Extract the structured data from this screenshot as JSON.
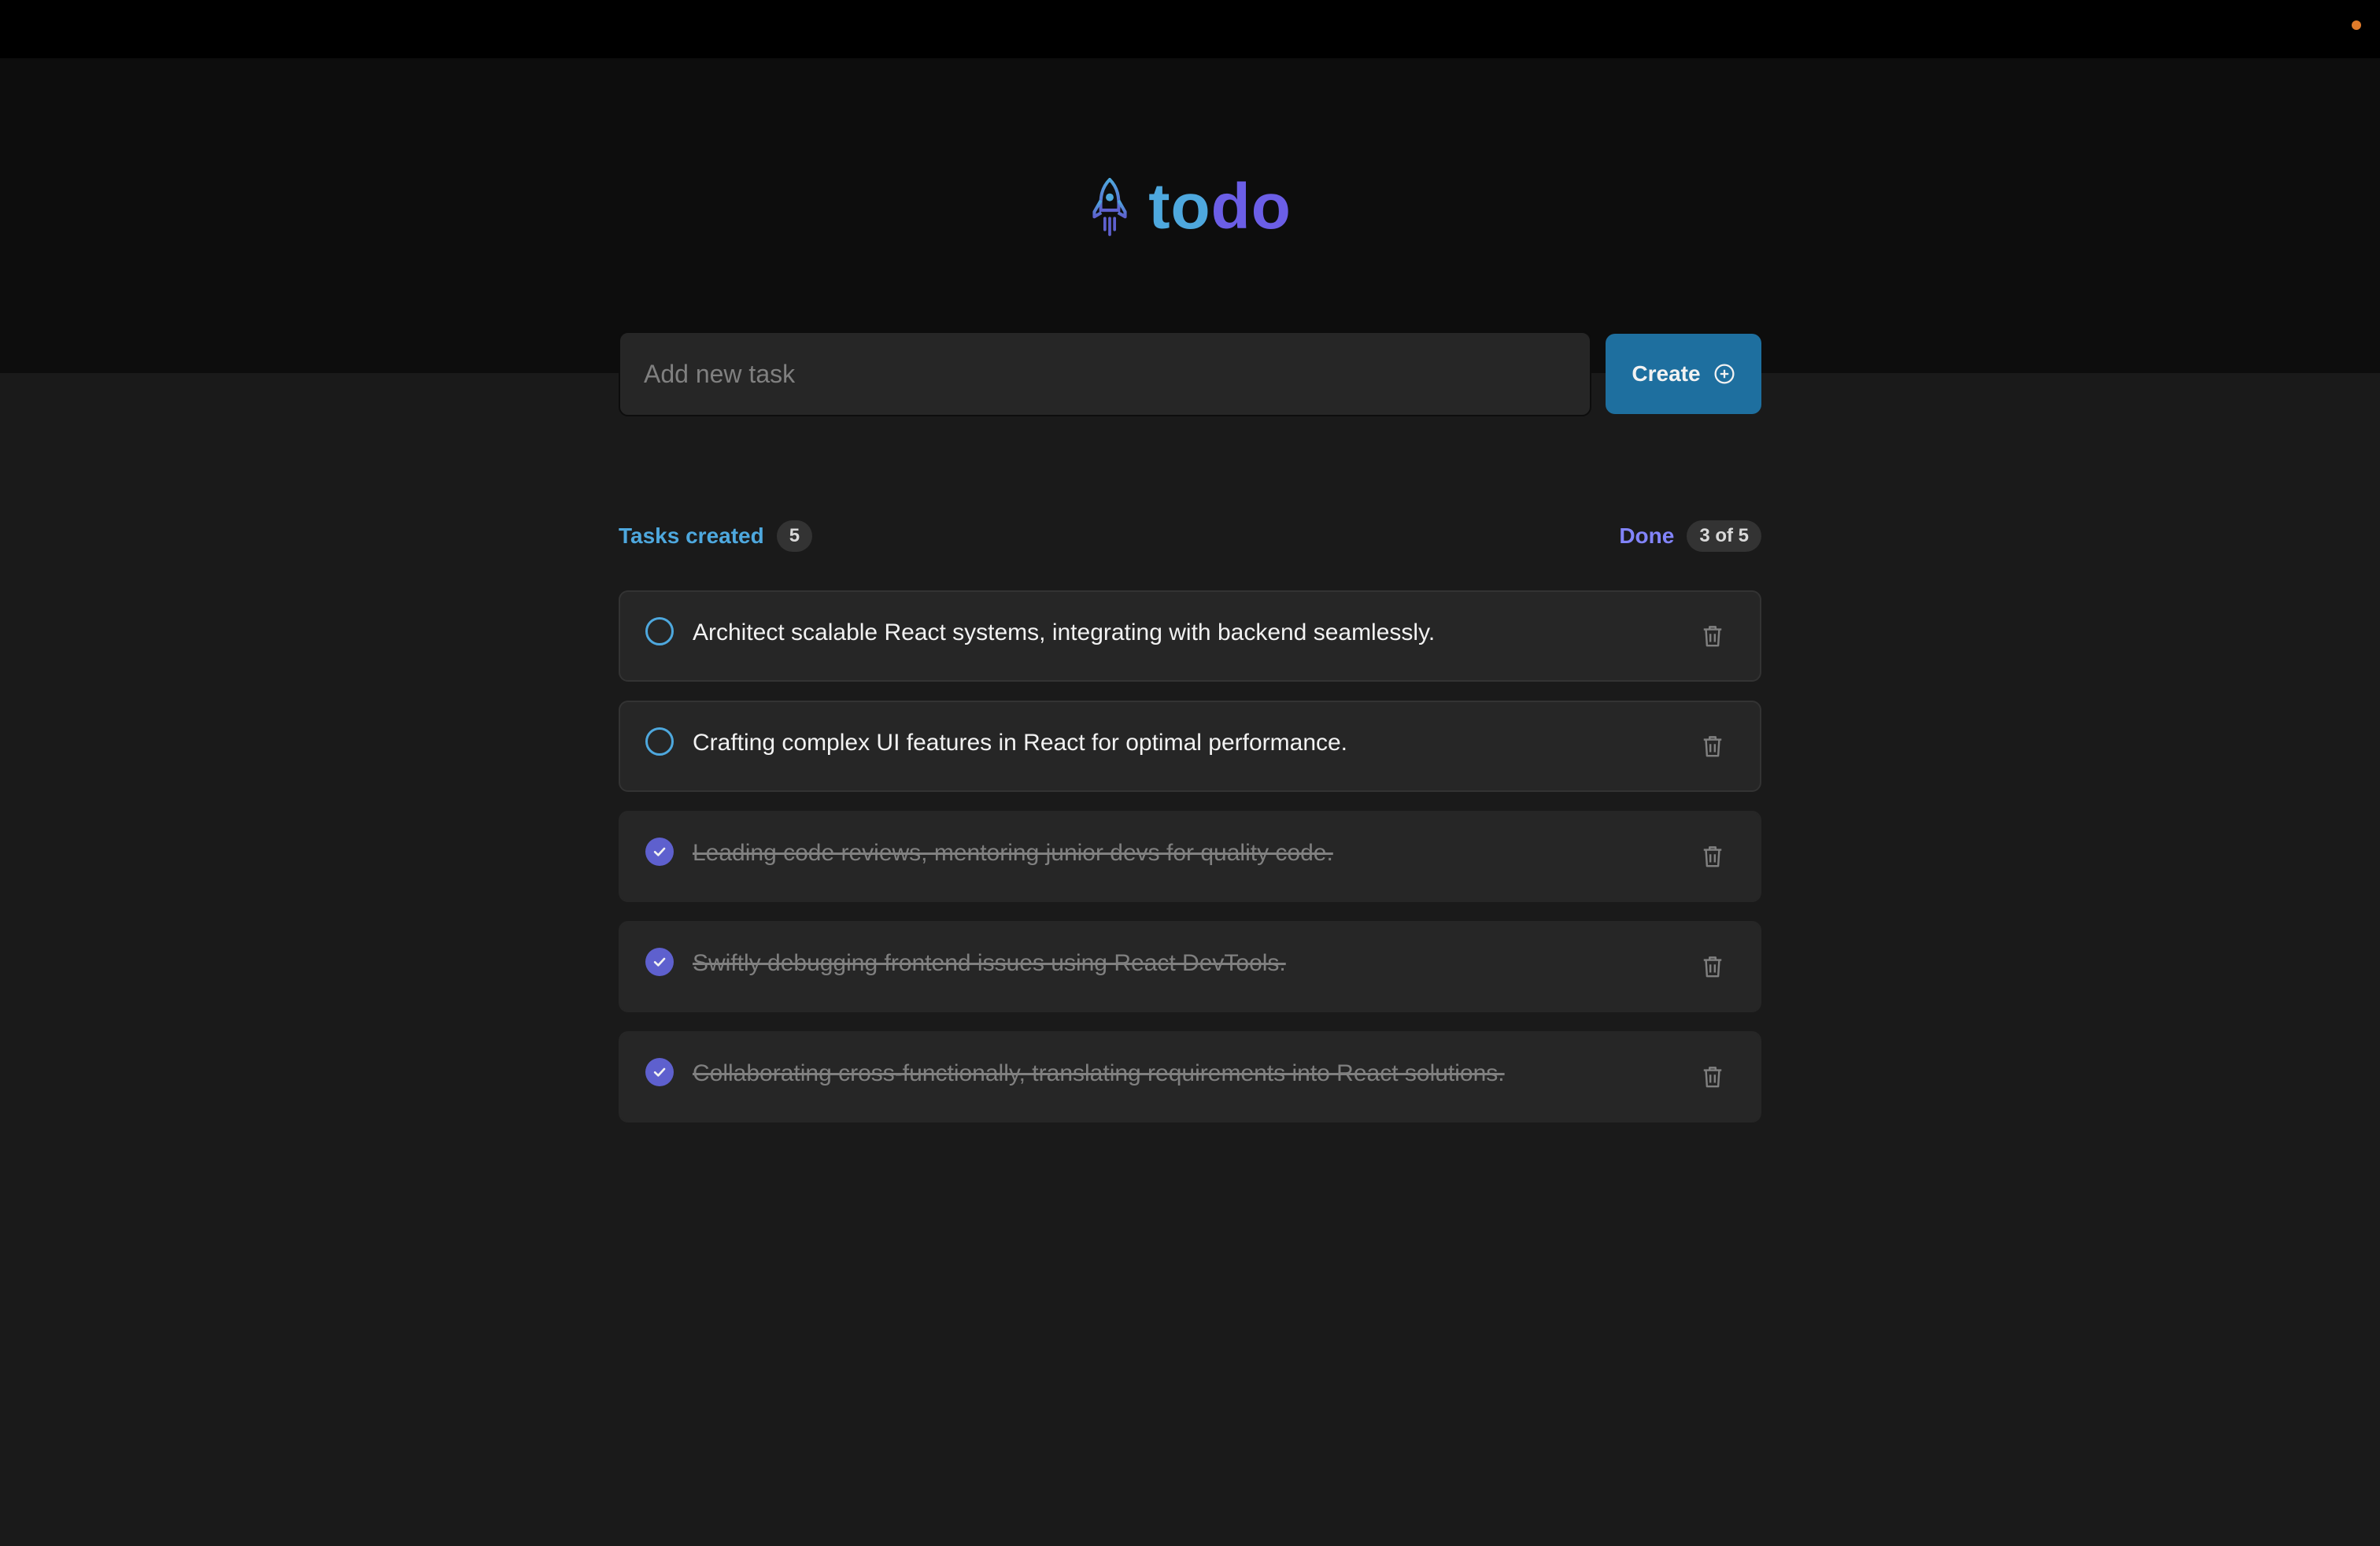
{
  "app": {
    "title_part1": "to",
    "title_part2": "do",
    "logo_icon": "rocket-icon"
  },
  "form": {
    "placeholder": "Add new task",
    "value": "",
    "create_label": "Create",
    "create_icon": "plus-circle-icon"
  },
  "counters": {
    "created_label": "Tasks created",
    "created_count": "5",
    "done_label": "Done",
    "done_count": "3 of 5"
  },
  "tasks": [
    {
      "text": "Architect scalable React systems, integrating with backend seamlessly.",
      "done": false
    },
    {
      "text": "Crafting complex UI features in React for optimal performance.",
      "done": false
    },
    {
      "text": "Leading code reviews, mentoring junior devs for quality code.",
      "done": true
    },
    {
      "text": "Swiftly debugging frontend issues using React DevTools.",
      "done": true
    },
    {
      "text": "Collaborating cross-functionally, translating requirements into React solutions.",
      "done": true
    }
  ],
  "colors": {
    "blue": "#4ea8de",
    "purple": "#5e60ce",
    "purple_light": "#8284fa",
    "button": "#1e6f9f",
    "background": "#1a1a1a",
    "header": "#0d0d0d",
    "card": "#262626"
  }
}
